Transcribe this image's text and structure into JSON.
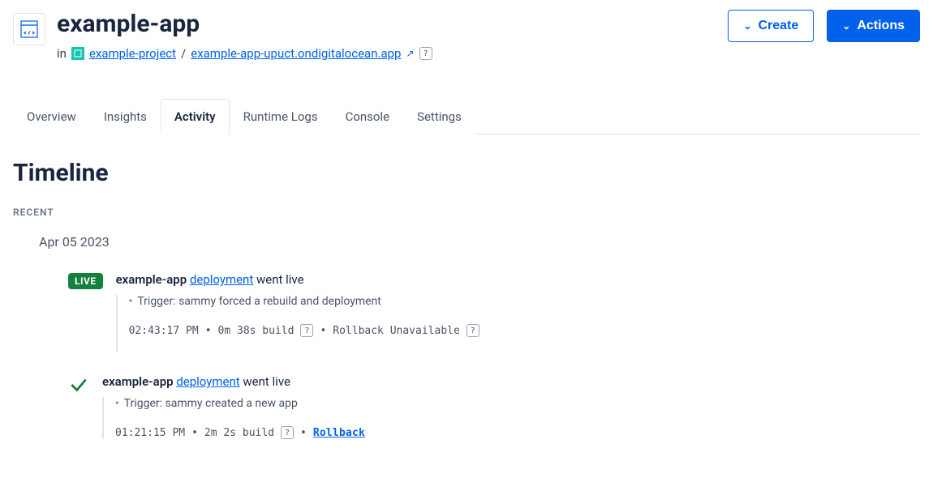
{
  "header": {
    "app_name": "example-app",
    "in_label": "in",
    "project_link": "example-project",
    "separator": "/",
    "url_link": "example-app-upuct.ondigitalocean.app",
    "create_label": "Create",
    "actions_label": "Actions"
  },
  "tabs": [
    {
      "label": "Overview",
      "active": false
    },
    {
      "label": "Insights",
      "active": false
    },
    {
      "label": "Activity",
      "active": true
    },
    {
      "label": "Runtime Logs",
      "active": false
    },
    {
      "label": "Console",
      "active": false
    },
    {
      "label": "Settings",
      "active": false
    }
  ],
  "timeline": {
    "title": "Timeline",
    "section": "RECENT",
    "date": "Apr 05 2023",
    "events": [
      {
        "badge": "LIVE",
        "app": "example-app",
        "link_text": "deployment",
        "suffix": "went live",
        "trigger": "Trigger: sammy forced a rebuild and deployment",
        "time": "02:43:17 PM",
        "build": "0m 38s build",
        "rollback_text": "Rollback Unavailable",
        "rollback_link": false
      },
      {
        "badge": "CHECK",
        "app": "example-app",
        "link_text": "deployment",
        "suffix": "went live",
        "trigger": "Trigger: sammy created a new app",
        "time": "01:21:15 PM",
        "build": "2m 2s build",
        "rollback_text": "Rollback",
        "rollback_link": true
      }
    ]
  }
}
